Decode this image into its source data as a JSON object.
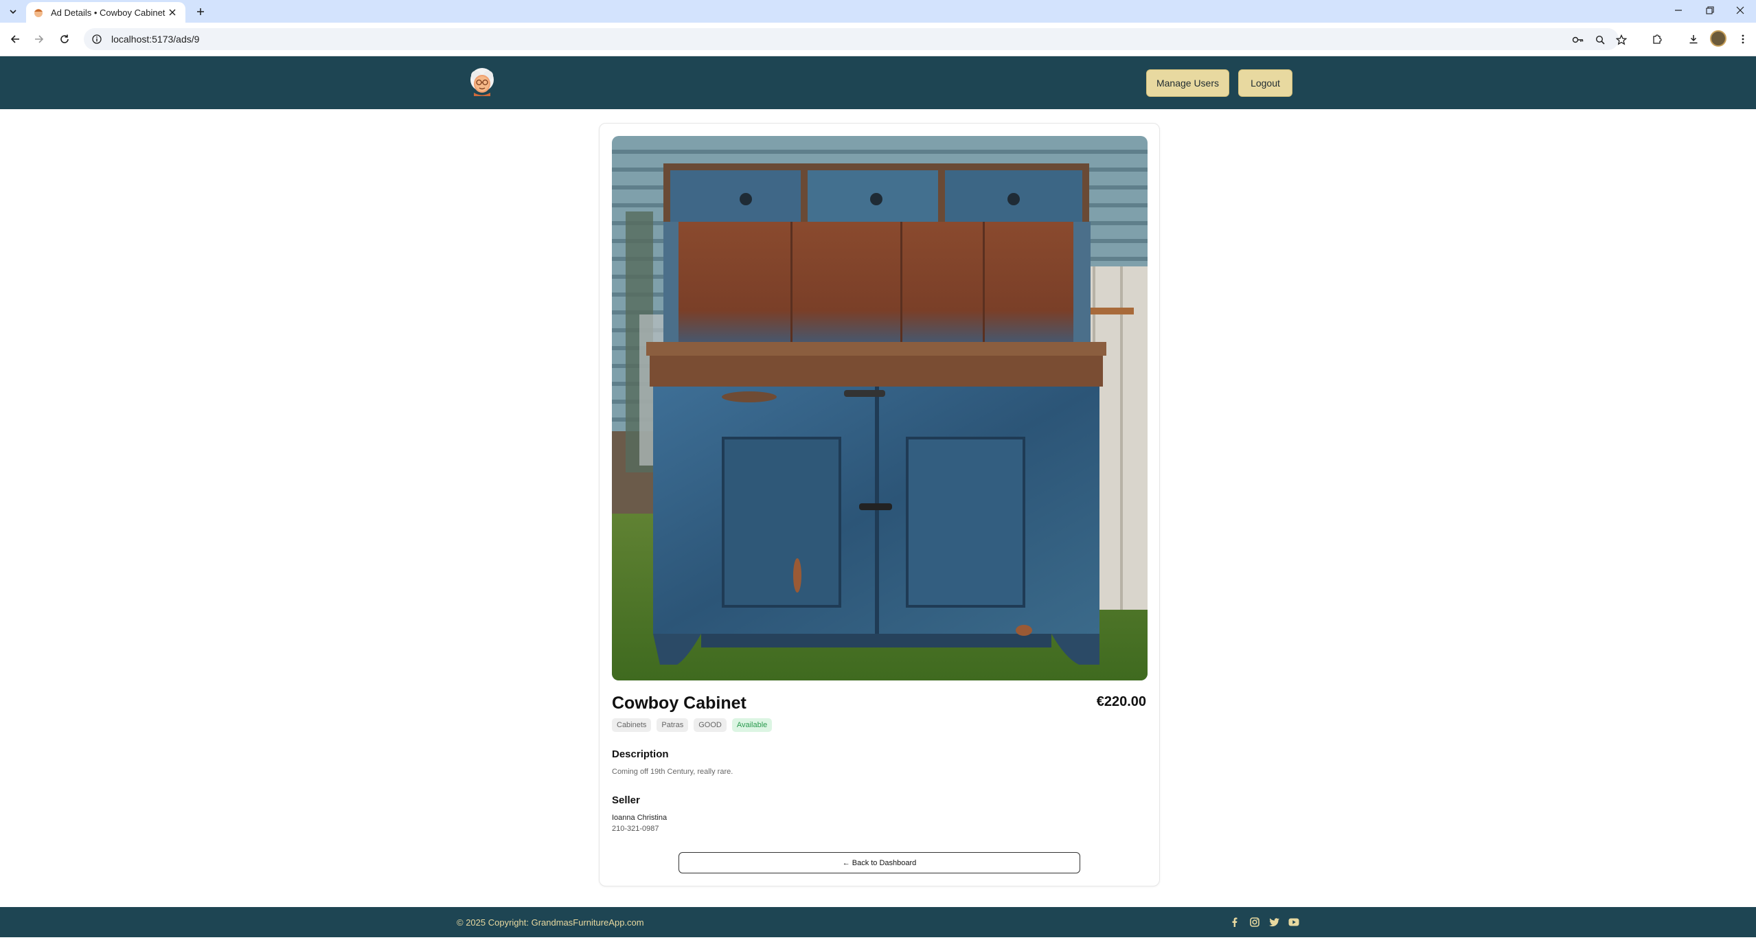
{
  "browser": {
    "tab_title": "Ad Details • Cowboy Cabinet",
    "url": "localhost:5173/ads/9"
  },
  "header": {
    "manage_users_label": "Manage Users",
    "logout_label": "Logout"
  },
  "ad": {
    "title": "Cowboy Cabinet",
    "price": "€220.00",
    "tags": [
      "Cabinets",
      "Patras",
      "GOOD",
      "Available"
    ],
    "description_heading": "Description",
    "description": "Coming off 19th Century, really rare.",
    "seller_heading": "Seller",
    "seller_name": "Ioanna Christina",
    "seller_phone": "210-321-0987",
    "back_label": "← Back to Dashboard"
  },
  "footer": {
    "copyright": "© 2025 Copyright: GrandmasFurnitureApp.com",
    "social_icons": [
      "facebook-icon",
      "instagram-icon",
      "twitter-icon",
      "youtube-icon"
    ]
  },
  "colors": {
    "header_bg": "#1e4553",
    "button_bg": "#e8d9a0",
    "available_bg": "#dcf5e3",
    "available_text": "#2a9a4e"
  }
}
